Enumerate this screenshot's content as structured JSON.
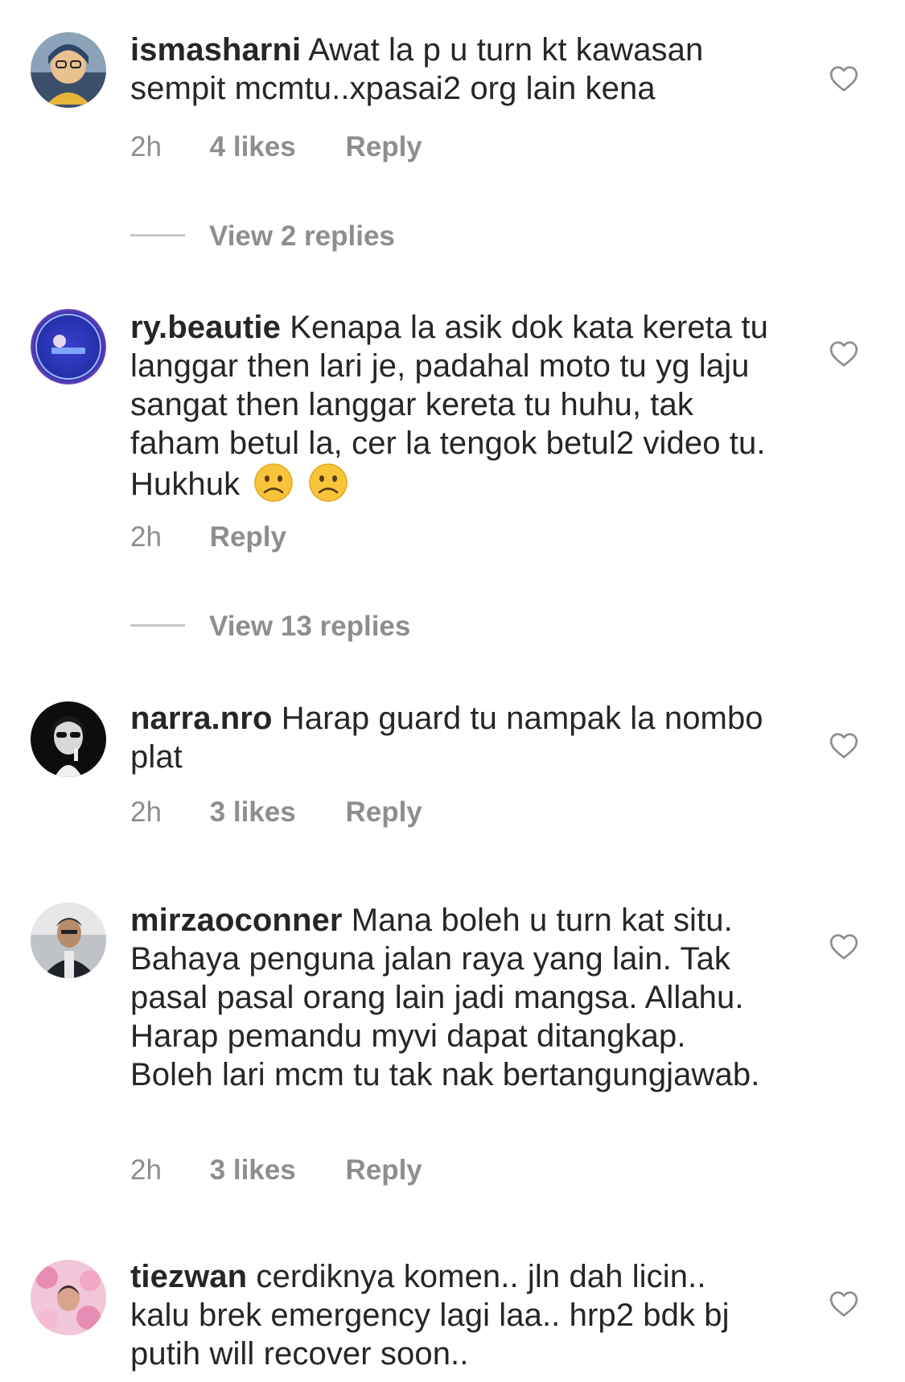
{
  "comments": [
    {
      "username": "ismasharni",
      "text": "Awat la p u turn kt kawasan sempit mcmtu..xpasai2 org lain kena",
      "time": "2h",
      "likes": "4 likes",
      "reply": "Reply",
      "view_replies": "View 2 replies"
    },
    {
      "username": "ry.beautie",
      "text": "Kenapa la asik dok kata kereta tu langgar then lari je, padahal moto tu yg laju sangat then langgar kereta tu huhu, tak faham betul la, cer la tengok betul2 video tu. Hukhuk",
      "emojis": [
        "☹",
        "☹"
      ],
      "time": "2h",
      "reply": "Reply",
      "view_replies": "View 13 replies"
    },
    {
      "username": "narra.nro",
      "text": "Harap guard tu nampak la nombo plat",
      "time": "2h",
      "likes": "3 likes",
      "reply": "Reply"
    },
    {
      "username": "mirzaoconner",
      "text": "Mana boleh u turn kat situ. Bahaya penguna jalan raya yang lain. Tak pasal pasal orang lain jadi mangsa. Allahu. Harap pemandu myvi dapat ditangkap. Boleh lari mcm tu tak nak bertangungjawab.",
      "time": "2h",
      "likes": "3 likes",
      "reply": "Reply"
    },
    {
      "username": "tiezwan",
      "text": "cerdiknya komen.. jln dah licin.. kalu brek emergency lagi laa.. hrp2 bdk bj putih will recover soon.."
    }
  ],
  "icons": {
    "like": "heart-outline-icon",
    "emoji": "frowning-face-emoji"
  },
  "colors": {
    "text": "#262626",
    "secondary": "#8e8e8e",
    "divider": "#c7c7c7"
  }
}
